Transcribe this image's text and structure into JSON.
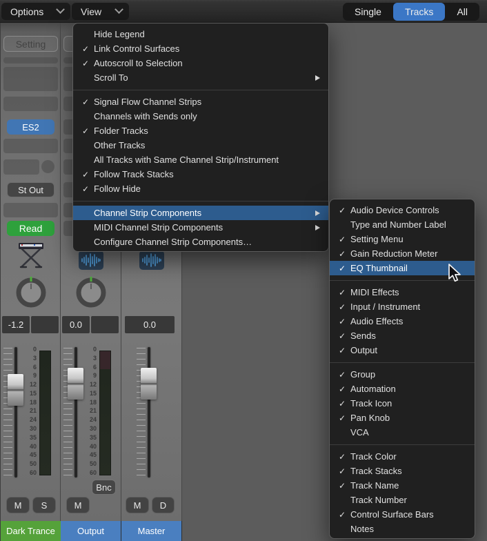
{
  "toolbar": {
    "options_label": "Options",
    "view_label": "View",
    "segments": [
      {
        "label": "Single",
        "selected": false
      },
      {
        "label": "Tracks",
        "selected": true
      },
      {
        "label": "All",
        "selected": false
      }
    ]
  },
  "view_menu": {
    "items": [
      {
        "type": "item",
        "label": "Hide Legend",
        "checked": false
      },
      {
        "type": "item",
        "label": "Link Control Surfaces",
        "checked": true
      },
      {
        "type": "item",
        "label": "Autoscroll to Selection",
        "checked": true
      },
      {
        "type": "item",
        "label": "Scroll To",
        "checked": false,
        "has_submenu": true
      },
      {
        "type": "separator"
      },
      {
        "type": "item",
        "label": "Signal Flow Channel Strips",
        "checked": true
      },
      {
        "type": "item",
        "label": "Channels with Sends only",
        "checked": false
      },
      {
        "type": "item",
        "label": "Folder Tracks",
        "checked": true
      },
      {
        "type": "item",
        "label": "Other Tracks",
        "checked": false
      },
      {
        "type": "item",
        "label": "All Tracks with Same Channel Strip/Instrument",
        "checked": false
      },
      {
        "type": "item",
        "label": "Follow Track Stacks",
        "checked": true
      },
      {
        "type": "item",
        "label": "Follow Hide",
        "checked": true
      },
      {
        "type": "separator"
      },
      {
        "type": "item",
        "label": "Channel Strip Components",
        "checked": false,
        "has_submenu": true,
        "highlighted": true
      },
      {
        "type": "item",
        "label": "MIDI Channel Strip Components",
        "checked": false,
        "has_submenu": true
      },
      {
        "type": "item",
        "label": "Configure Channel Strip Components…",
        "checked": false
      }
    ]
  },
  "components_submenu": {
    "items": [
      {
        "type": "item",
        "label": "Audio Device Controls",
        "checked": true
      },
      {
        "type": "item",
        "label": "Type and Number Label",
        "checked": false
      },
      {
        "type": "item",
        "label": "Setting Menu",
        "checked": true
      },
      {
        "type": "item",
        "label": "Gain Reduction Meter",
        "checked": true
      },
      {
        "type": "item",
        "label": "EQ Thumbnail",
        "checked": true,
        "highlighted": true
      },
      {
        "type": "separator"
      },
      {
        "type": "item",
        "label": "MIDI Effects",
        "checked": true
      },
      {
        "type": "item",
        "label": "Input / Instrument",
        "checked": true
      },
      {
        "type": "item",
        "label": "Audio Effects",
        "checked": true
      },
      {
        "type": "item",
        "label": "Sends",
        "checked": true
      },
      {
        "type": "item",
        "label": "Output",
        "checked": true
      },
      {
        "type": "separator"
      },
      {
        "type": "item",
        "label": "Group",
        "checked": true
      },
      {
        "type": "item",
        "label": "Automation",
        "checked": true
      },
      {
        "type": "item",
        "label": "Track Icon",
        "checked": true
      },
      {
        "type": "item",
        "label": "Pan Knob",
        "checked": true
      },
      {
        "type": "item",
        "label": "VCA",
        "checked": false
      },
      {
        "type": "separator"
      },
      {
        "type": "item",
        "label": "Track Color",
        "checked": true
      },
      {
        "type": "item",
        "label": "Track Stacks",
        "checked": true
      },
      {
        "type": "item",
        "label": "Track Name",
        "checked": true
      },
      {
        "type": "item",
        "label": "Track Number",
        "checked": false
      },
      {
        "type": "item",
        "label": "Control Surface Bars",
        "checked": true
      },
      {
        "type": "item",
        "label": "Notes",
        "checked": false
      }
    ]
  },
  "mixer": {
    "fader_scale": [
      "0",
      "3",
      "6",
      "9",
      "12",
      "15",
      "18",
      "21",
      "24",
      "30",
      "35",
      "40",
      "45",
      "50",
      "60"
    ],
    "strips": [
      {
        "name": "Dark Trance",
        "name_color": "#55a23a",
        "setting_label": "Setting",
        "instrument_label": "ES2",
        "output_label": "St Out",
        "automation_label": "Read",
        "pan_value": "-1.2",
        "peak_value": "",
        "mute_label": "M",
        "solo_label": "S"
      },
      {
        "name": "Output",
        "name_color": "#4a7fc0",
        "pan_value": "0.0",
        "peak_value": "",
        "bounce_label": "Bnc",
        "mute_label": "M"
      },
      {
        "name": "Master",
        "name_color": "#4a7fc0",
        "volume_value": "0.0",
        "mute_label": "M",
        "dim_label": "D"
      }
    ]
  },
  "colors": {
    "menu_highlight": "#2d5c8e",
    "selected_segment_blue": "#3b77c6",
    "instrument_blue": "#4176b4",
    "automation_green": "#2ea13c"
  }
}
